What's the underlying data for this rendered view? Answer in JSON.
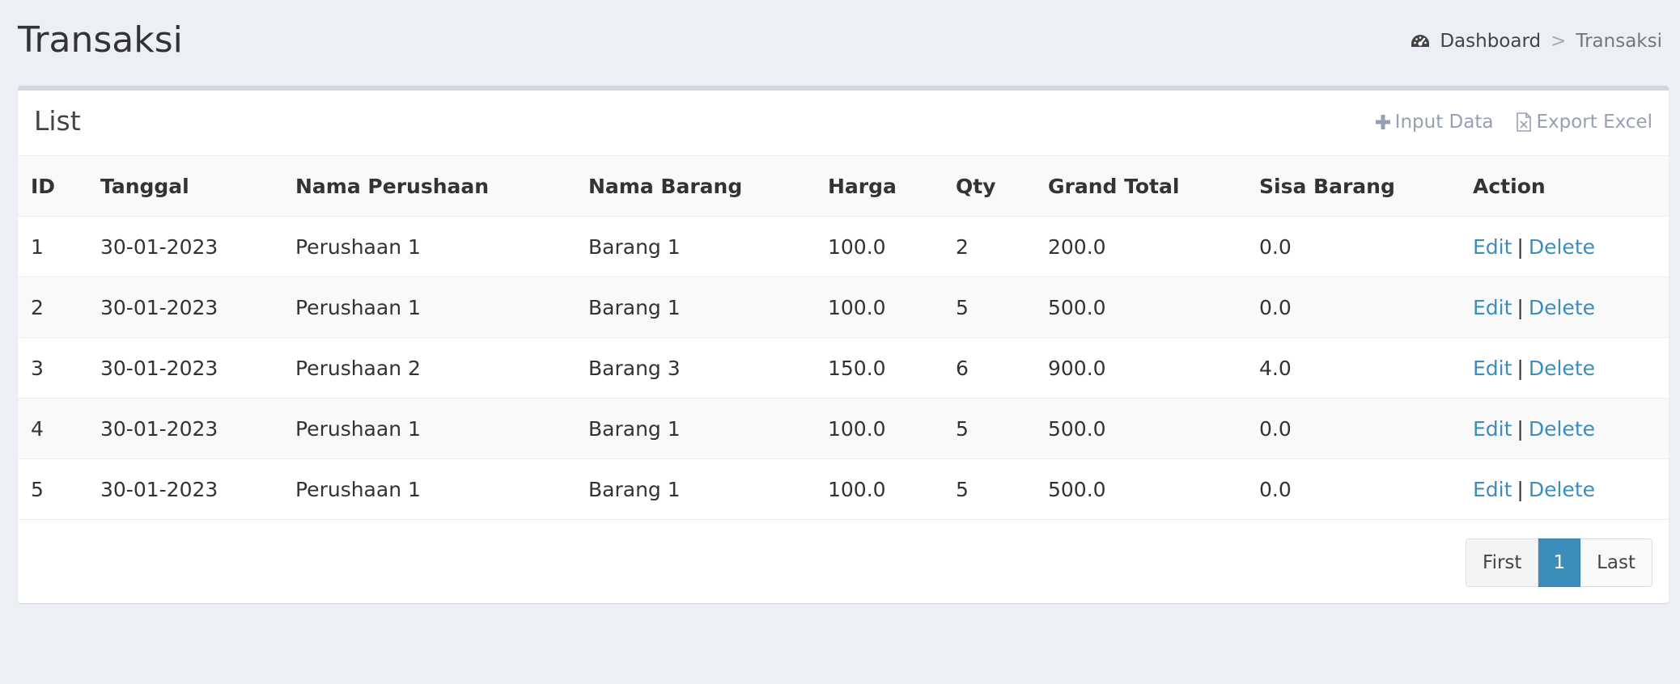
{
  "page": {
    "title": "Transaksi"
  },
  "breadcrumb": {
    "home_icon": "dashboard-icon",
    "home_label": "Dashboard",
    "separator": ">",
    "current": "Transaksi"
  },
  "box": {
    "title": "List",
    "tools": {
      "input_label": "Input Data",
      "input_icon": "plus-icon",
      "export_label": "Export Excel",
      "export_icon": "excel-file-icon"
    }
  },
  "table": {
    "headers": [
      "ID",
      "Tanggal",
      "Nama Perushaan",
      "Nama Barang",
      "Harga",
      "Qty",
      "Grand Total",
      "Sisa Barang",
      "Action"
    ],
    "rows": [
      {
        "id": "1",
        "tanggal": "30-01-2023",
        "perusahaan": "Perushaan 1",
        "barang": "Barang 1",
        "harga": "100.0",
        "qty": "2",
        "grand_total": "200.0",
        "sisa": "0.0"
      },
      {
        "id": "2",
        "tanggal": "30-01-2023",
        "perusahaan": "Perushaan 1",
        "barang": "Barang 1",
        "harga": "100.0",
        "qty": "5",
        "grand_total": "500.0",
        "sisa": "0.0"
      },
      {
        "id": "3",
        "tanggal": "30-01-2023",
        "perusahaan": "Perushaan 2",
        "barang": "Barang 3",
        "harga": "150.0",
        "qty": "6",
        "grand_total": "900.0",
        "sisa": "4.0"
      },
      {
        "id": "4",
        "tanggal": "30-01-2023",
        "perusahaan": "Perushaan 1",
        "barang": "Barang 1",
        "harga": "100.0",
        "qty": "5",
        "grand_total": "500.0",
        "sisa": "0.0"
      },
      {
        "id": "5",
        "tanggal": "30-01-2023",
        "perusahaan": "Perushaan 1",
        "barang": "Barang 1",
        "harga": "100.0",
        "qty": "5",
        "grand_total": "500.0",
        "sisa": "0.0"
      }
    ],
    "actions": {
      "edit_label": "Edit",
      "separator": "|",
      "delete_label": "Delete"
    }
  },
  "pagination": {
    "first": "First",
    "current": "1",
    "last": "Last"
  },
  "colors": {
    "link": "#3c8dbc",
    "active_page": "#3c8dbc",
    "background": "#ecf0f5"
  }
}
